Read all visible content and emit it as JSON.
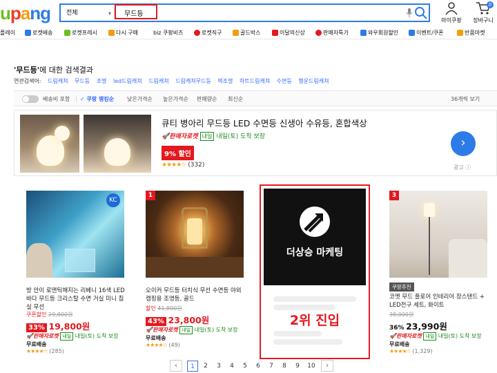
{
  "header": {
    "logo": "upang",
    "category_select": "전체",
    "search_value": "무드등",
    "my_label": "마이쿠팡",
    "cart_label": "장바구니",
    "cart_count": "0"
  },
  "catnav": [
    {
      "label": "플레이",
      "icon": "play-icon",
      "color": "#2d7be8"
    },
    {
      "label": "로켓배송",
      "icon": "rocket-icon",
      "color": "#2d7be8"
    },
    {
      "label": "로켓프레시",
      "icon": "rocket-fresh-icon",
      "color": "#6cbf1d"
    },
    {
      "label": "다시 구매",
      "icon": "rebuy-icon",
      "color": "#f39c12"
    },
    {
      "label": "biz 쿠팡비즈",
      "icon": "biz-icon",
      "color": "#111111"
    },
    {
      "label": "로켓직구",
      "icon": "globe-icon",
      "color": "#e4181f"
    },
    {
      "label": "골드박스",
      "icon": "goldbox-icon",
      "color": "#f39c12"
    },
    {
      "label": "이달의신상",
      "icon": "new-icon",
      "color": "#e4181f"
    },
    {
      "label": "판매자특가",
      "icon": "percent-icon",
      "color": "#e4181f"
    },
    {
      "label": "와우회원할인",
      "icon": "wow-icon",
      "color": "#2d7be8"
    },
    {
      "label": "이벤트/쿠폰",
      "icon": "coupon-icon",
      "color": "#2d7be8"
    },
    {
      "label": "반품마켓",
      "icon": "return-icon",
      "color": "#f39c12"
    }
  ],
  "results": {
    "keyword": "'무드등'",
    "suffix": "에 대한 검색결과",
    "related_label": "연관검색어:",
    "related": [
      "드림캐쳐",
      "무드등",
      "조명",
      "led드림캐쳐",
      "드림캐쳐",
      "드림캐쳐무드등",
      "벽조명",
      "하트드림캐쳐",
      "수면등",
      "행운드림캐쳐"
    ]
  },
  "filters": {
    "toggle_label": "배송비 포함",
    "sort_active": "✓ 쿠팡 랭킹순",
    "sorts": [
      "낮은가격순",
      "높은가격순",
      "판매량순",
      "최신순"
    ],
    "per_page": "36개씩 보기"
  },
  "ad": {
    "title": "큐티 병아리 무드등 LED 수면등 신생아 수유등, 혼합색상",
    "rocket": "판매자로켓",
    "tag": "내일",
    "delivery": "내일(토) 도착 보장",
    "discount": "9% 할인",
    "stars": "★★★★☆",
    "reviews": "(332)",
    "ad_label": "광고"
  },
  "products": [
    {
      "title": "방 안이 로맨틱해지는 리베니 16색 LED 바다 무드등 크리스탈 수면 거실 미니 침실 무선",
      "coupon": "쿠폰할인",
      "original": "29,800원",
      "discount": "33%",
      "price": "19,800원",
      "rocket": "판매자로켓",
      "tag": "내일",
      "delivery": "내일(토) 도착 보장",
      "shipping": "무료배송",
      "stars": "★★★★☆",
      "reviews": "(285)"
    },
    {
      "rank": "1",
      "title": "오이커 무드등 터치식 무선 수면등 야외 캠핑용 조명등, 골드",
      "coupon": "할인",
      "original": "41,800원",
      "discount": "43%",
      "price": "23,800원",
      "rocket": "판매자로켓",
      "tag": "내일",
      "delivery": "내일(토) 도착 보장",
      "shipping": "무료배송",
      "stars": "★★★★☆",
      "reviews": "(49)"
    },
    {
      "rank": "3",
      "badge": "쿠팡추천",
      "title": "코멧 무드 플로어 인테리어 장스탠드 + LED전구 세트, 화이트",
      "original": "38,000원",
      "discount": "36%",
      "price": "23,990원",
      "rocket": "판매자로켓",
      "tag": "내일",
      "delivery": "내일(토) 도착 보장",
      "shipping": "무료배송",
      "stars": "★★★★☆",
      "reviews": "(1,329)"
    }
  ],
  "highlight": {
    "brand": "더상승 마케팅",
    "rank_text": "2위 진입"
  },
  "pagination": {
    "pages": [
      "1",
      "2",
      "3",
      "4",
      "5",
      "6",
      "7",
      "8",
      "9",
      "10"
    ],
    "current": "1"
  }
}
